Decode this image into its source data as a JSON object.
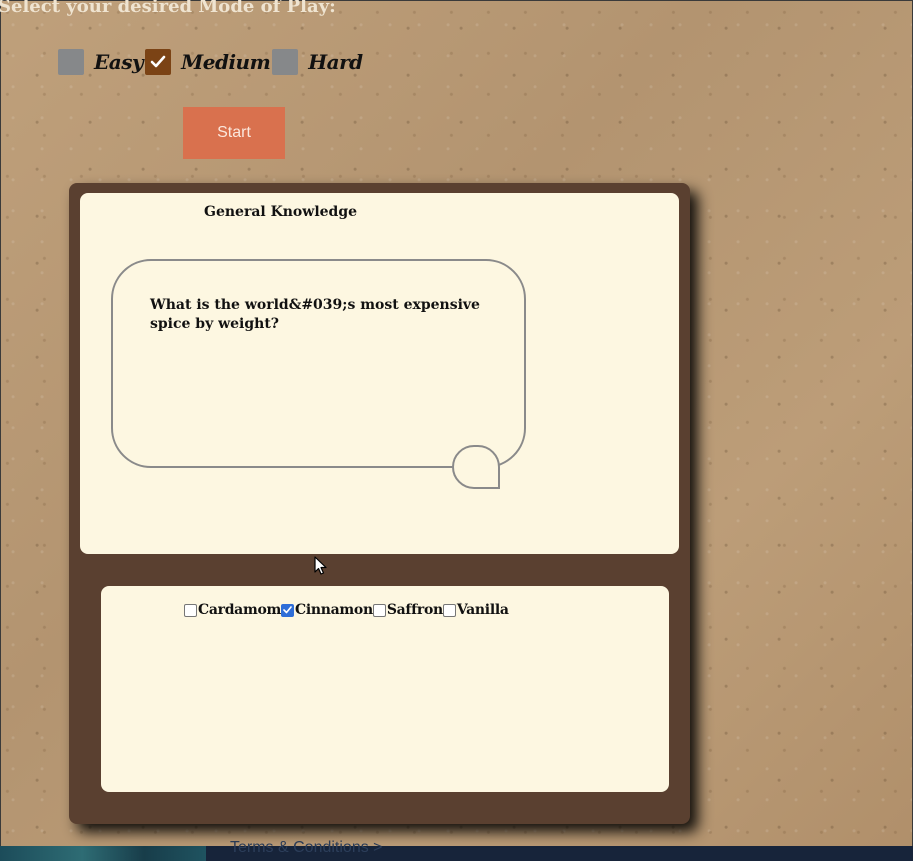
{
  "mode_prompt": "Select your desired Mode of Play:",
  "modes": [
    {
      "label": "Easy",
      "checked": false
    },
    {
      "label": "Medium",
      "checked": true
    },
    {
      "label": "Hard",
      "checked": false
    }
  ],
  "start_label": "Start",
  "quiz": {
    "category": "General Knowledge",
    "question": "What is the world&#039;s most expensive spice by weight?",
    "options": [
      {
        "label": "Cardamom",
        "checked": false
      },
      {
        "label": "Cinnamon",
        "checked": true
      },
      {
        "label": "Saffron",
        "checked": false
      },
      {
        "label": "Vanilla",
        "checked": false
      }
    ]
  },
  "footer": {
    "link": "Terms & Conditions >"
  },
  "colors": {
    "mode_checked": "#7b4315",
    "mode_unchecked": "#86888a",
    "start_button": "#d9714e",
    "card_frame": "#5a4030",
    "panel": "#fdf7e1",
    "answer_checked": "#2f6ed8"
  }
}
